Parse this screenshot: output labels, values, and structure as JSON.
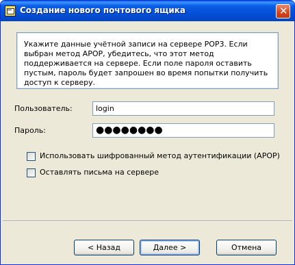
{
  "window": {
    "title": "Создание нового почтового ящика",
    "close_glyph": "✕"
  },
  "info": {
    "text": "Укажите данные учётной записи на сервере POP3. Если выбран метод APOP, убедитесь, что этот метод поддерживается на сервере. Если поле пароля оставить пустым, пароль будет запрошен во время попытки получить доступ к серверу."
  },
  "form": {
    "user_label": "Пользователь:",
    "user_value": "login",
    "password_label": "Пароль:",
    "password_value": "●●●●●●●●"
  },
  "options": {
    "apop_label": "Использовать шифрованный метод аутентификации (APOP)",
    "apop_checked": false,
    "keep_label": "Оставлять письма на сервере",
    "keep_checked": false
  },
  "buttons": {
    "back": "< Назад",
    "next": "Далее >",
    "cancel": "Отмена"
  },
  "colors": {
    "title_bar": "#0a5fe5",
    "close_button": "#d4461e",
    "panel_border": "#7f9db9"
  },
  "icons": {
    "app": "mail-app-icon",
    "close": "close-icon"
  }
}
